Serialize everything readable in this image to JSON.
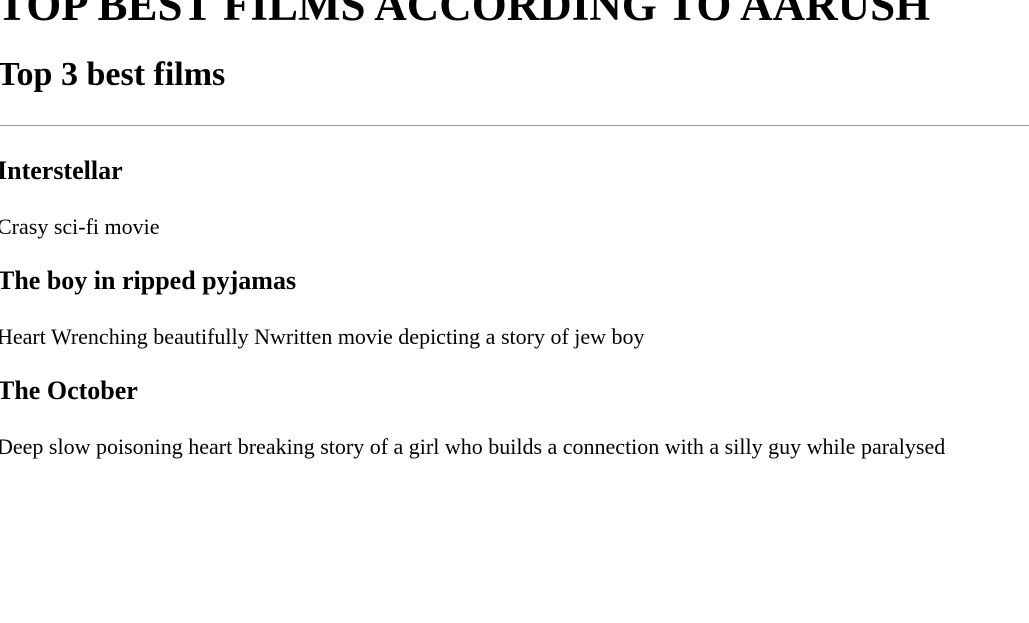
{
  "page": {
    "heading": "TOP BEST FILMS ACCORDING TO AARUSH",
    "subheading": "Top 3 best films"
  },
  "films": [
    {
      "title": "Interstellar",
      "description": "Crasy sci-fi movie"
    },
    {
      "title": "The boy in ripped pyjamas",
      "description": "Heart Wrenching beautifully Nwritten movie depicting a story of jew boy"
    },
    {
      "title": "The October",
      "description": "Deep slow poisoning heart breaking story of a girl who builds a connection with a silly guy while paralysed"
    }
  ]
}
